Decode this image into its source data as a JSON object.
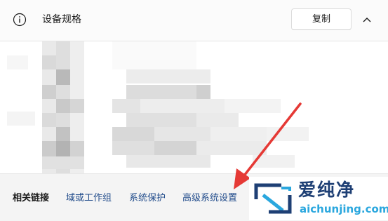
{
  "header": {
    "icon": "info-icon",
    "title": "设备规格",
    "copy_label": "复制",
    "collapse_icon": "chevron-up-icon"
  },
  "content": {
    "obscured": true
  },
  "footer": {
    "label": "相关链接",
    "links": [
      {
        "label": "域或工作组"
      },
      {
        "label": "系统保护"
      },
      {
        "label": "高级系统设置"
      }
    ]
  },
  "annotation": {
    "arrow_color": "#e53935"
  },
  "watermark": {
    "name": "爱纯净",
    "url": "aichunjing.com"
  },
  "colors": {
    "link": "#1f4a8a",
    "watermark_dark": "#1e3f74",
    "watermark_light": "#2aa7de"
  }
}
